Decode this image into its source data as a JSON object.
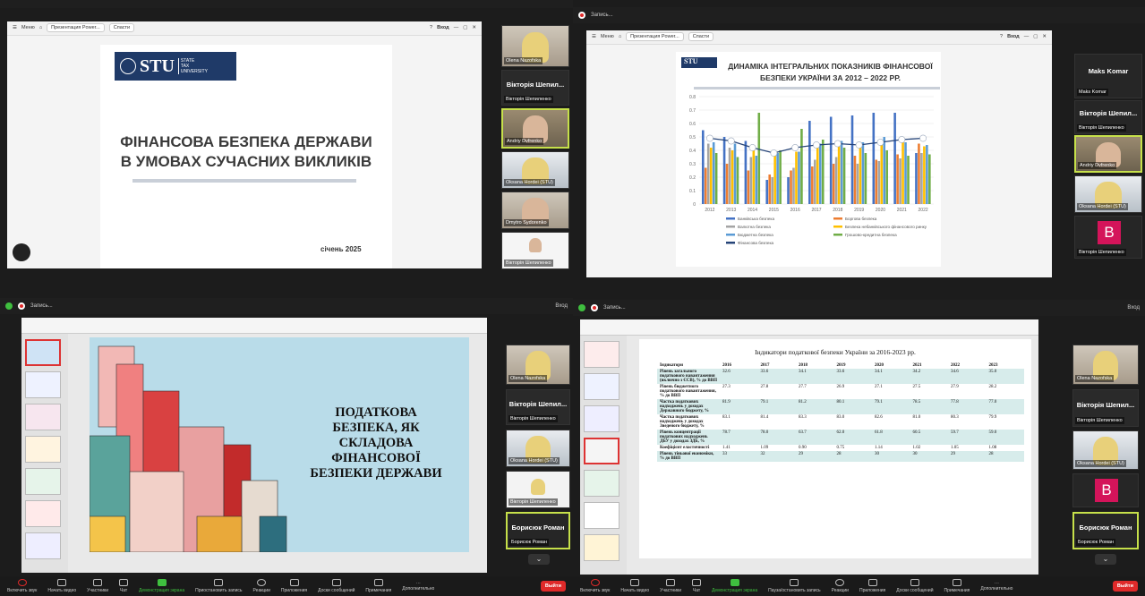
{
  "q1": {
    "browser": {
      "menu": "Меню",
      "tab": "Презентация Power...",
      "share": "Спасти",
      "signin": "Вход"
    },
    "slide": {
      "logo": "STU",
      "logo_sub1": "STATE",
      "logo_sub2": "TAX",
      "logo_sub3": "UNIVERSITY",
      "title_line1": "ФІНАНСОВА БЕЗПЕКА ДЕРЖАВИ",
      "title_line2": "В УМОВАХ СУЧАСНИХ ВИКЛИКІВ",
      "date": "січень 2025"
    },
    "participants": [
      {
        "name": "Olena Nazofska"
      },
      {
        "name": "Вікторія Шепил...",
        "label": "Вікторія Шепиленко"
      },
      {
        "name": "Andriy Dvfrenko"
      },
      {
        "name": "Oksana Hordei (STU)"
      },
      {
        "name": "Dmytro Sydorenko"
      },
      {
        "name": "Вікторія Шепиленко"
      }
    ]
  },
  "q2": {
    "rec": "Запись...",
    "browser": {
      "menu": "Меню",
      "tab": "Презентация Power...",
      "share": "Спасти",
      "signin": "Вход"
    },
    "participants": [
      {
        "name": "Maks Komar",
        "label": "Maks Komar"
      },
      {
        "name": "Вікторія Шепил...",
        "label": "Вікторія Шепиленко"
      },
      {
        "name": "Andriy Dvfrenko"
      },
      {
        "name": "Oksana Hordei (STU)"
      },
      {
        "name": "B",
        "label": "Вікторія Шепиленко"
      }
    ]
  },
  "q3": {
    "rec": "Запись...",
    "signin": "Вход",
    "slide": {
      "l1": "ПОДАТКОВА",
      "l2": "БЕЗПЕКА, ЯК",
      "l3": "СКЛАДОВА",
      "l4": "ФІНАНСОВОЇ",
      "l5": "БЕЗПЕКИ ДЕРЖАВИ"
    },
    "participants": [
      {
        "name": "Olena Nazofska"
      },
      {
        "name": "Вікторія Шепил...",
        "label": "Вікторія Шепиленко"
      },
      {
        "name": "Oksana Hordei (STU)"
      },
      {
        "name": "Вікторія Шепиленко"
      },
      {
        "name": "Борисюк Роман",
        "label": "Борисюк Роман"
      }
    ],
    "controls": [
      "Включить звук",
      "Начать видео",
      "Участники",
      "Чат",
      "Демонстрация экрана",
      "Приостановить запись",
      "Реакции",
      "Приложения",
      "Доски сообщений",
      "Примечания",
      "Дополнительно"
    ],
    "leave": "Выйти"
  },
  "q4": {
    "rec": "Запись...",
    "signin": "Вход",
    "table_title": "Індикатори податкової безпеки України за 2016-2023 рр.",
    "table": {
      "headers": [
        "Індикатори",
        "2016",
        "2017",
        "2018",
        "2019",
        "2020",
        "2021",
        "2022",
        "2023"
      ],
      "rows": [
        [
          "Рівень загального податкового навантаження (включно з ЄСВ), % до ВВП",
          "32.6",
          "33.6",
          "34.1",
          "33.6",
          "34.1",
          "34.2",
          "34.6",
          "35.0"
        ],
        [
          "Рівень бюджетного податкового навантаження, % до ВВП",
          "27.3",
          "27.8",
          "27.7",
          "26.9",
          "27.1",
          "27.5",
          "27.9",
          "28.2"
        ],
        [
          "Частка податкових надходжень у доходах Державного бюджету, %",
          "81.9",
          "79.1",
          "81.2",
          "80.1",
          "79.1",
          "78.5",
          "77.8",
          "77.0"
        ],
        [
          "Частка податкових надходжень у доходах Зведеного бюджету, %",
          "83.1",
          "81.4",
          "83.3",
          "83.0",
          "82.6",
          "81.0",
          "80.3",
          "79.9"
        ],
        [
          "Рівень концентрації податкових надходжень ДБУ у доходах ЗДБ, %",
          "78.7",
          "78.0",
          "63.7",
          "62.0",
          "61.8",
          "60.5",
          "59.7",
          "59.0"
        ],
        [
          "Коефіцієнт еластичності",
          "1.41",
          "1.09",
          "0.90",
          "0.75",
          "1.14",
          "1.02",
          "1.05",
          "1.08"
        ],
        [
          "Рівень тіньової економіки, % до ВВП",
          "33",
          "32",
          "29",
          "28",
          "30",
          "30",
          "29",
          "28"
        ]
      ]
    },
    "participants": [
      {
        "name": "Olena Nazofska"
      },
      {
        "name": "Вікторія Шепил...",
        "label": "Вікторія Шепиленко"
      },
      {
        "name": "Oksana Hordei (STU)"
      },
      {
        "name": "B"
      },
      {
        "name": "Борисюк Роман",
        "label": "Борисюк Роман"
      }
    ],
    "controls": [
      "Включить звук",
      "Начать видео",
      "Участники",
      "Чат",
      "Демонстрация экрана",
      "Пауза/остановить запись",
      "Реакции",
      "Приложения",
      "Доски сообщений",
      "Примечания",
      "Дополнительно"
    ],
    "leave": "Выйти"
  },
  "colors": {
    "green": "#c6e04a",
    "red": "#e02a2a",
    "pink": "#d4145a",
    "navy": "#1f3a68"
  },
  "chart_data": {
    "type": "bar",
    "title": "ДИНАМІКА ІНТЕГРАЛЬНИХ ПОКАЗНИКІВ ФІНАНСОВОЇ БЕЗПЕКИ УКРАЇНИ ЗА 2012 – 2022 РР.",
    "categories": [
      "2012",
      "2013",
      "2014",
      "2015",
      "2016",
      "2017",
      "2018",
      "2019",
      "2020",
      "2021",
      "2022"
    ],
    "ylim": [
      0,
      0.8
    ],
    "yticks": [
      "0",
      "0.1",
      "0.2",
      "0.3",
      "0.4",
      "0.5",
      "0.6",
      "0.7",
      "0.8"
    ],
    "series": [
      {
        "name": "Банківська безпека",
        "color": "#4472c4",
        "values": [
          0.55,
          0.5,
          0.47,
          0.18,
          0.2,
          0.62,
          0.65,
          0.66,
          0.68,
          0.68,
          0.38
        ]
      },
      {
        "name": "Боргова безпека",
        "color": "#ed7d31",
        "values": [
          0.27,
          0.3,
          0.25,
          0.22,
          0.25,
          0.28,
          0.3,
          0.36,
          0.33,
          0.37,
          0.45
        ]
      },
      {
        "name": "Валютна безпека",
        "color": "#a5a5a5",
        "values": [
          0.45,
          0.42,
          0.35,
          0.2,
          0.27,
          0.33,
          0.35,
          0.3,
          0.32,
          0.34,
          0.38
        ]
      },
      {
        "name": "Безпека небанківського фінансового ринку",
        "color": "#ffc000",
        "values": [
          0.42,
          0.4,
          0.44,
          0.37,
          0.39,
          0.42,
          0.43,
          0.44,
          0.45,
          0.46,
          0.43
        ]
      },
      {
        "name": "Бюджетна безпека",
        "color": "#5b9bd5",
        "values": [
          0.46,
          0.45,
          0.36,
          0.38,
          0.39,
          0.45,
          0.47,
          0.46,
          0.5,
          0.46,
          0.44
        ]
      },
      {
        "name": "Грошово-кредитна безпека",
        "color": "#70ad47",
        "values": [
          0.38,
          0.35,
          0.68,
          0.4,
          0.56,
          0.48,
          0.42,
          0.38,
          0.4,
          0.36,
          0.37
        ]
      }
    ],
    "line": {
      "name": "Фінансова безпека",
      "color": "#264478",
      "values": [
        0.49,
        0.47,
        0.42,
        0.38,
        0.42,
        0.44,
        0.45,
        0.44,
        0.46,
        0.48,
        0.49
      ]
    }
  }
}
